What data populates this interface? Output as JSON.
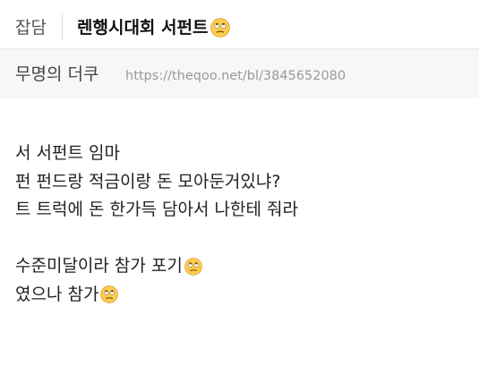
{
  "header": {
    "category": "잡담",
    "title": "렌행시대회 서펀트"
  },
  "meta": {
    "author": "무명의 더쿠",
    "url": "https://theqoo.net/bl/3845652080"
  },
  "icons": {
    "title_emoji": "eye-roll-emoji-icon",
    "inline_emoji": "eye-roll-emoji-icon"
  },
  "colors": {
    "emoji_face": "#ffcc4d",
    "emoji_outline": "#c28a1a"
  },
  "content": {
    "line1": "서 서펀트 임마",
    "line2": "펀 펀드랑 적금이랑 돈 모아둔거있냐?",
    "line3": "트 트럭에 돈 한가득 담아서 나한테 줘라",
    "line4": "수준미달이라 참가 포기",
    "line5": "였으나 참가"
  }
}
